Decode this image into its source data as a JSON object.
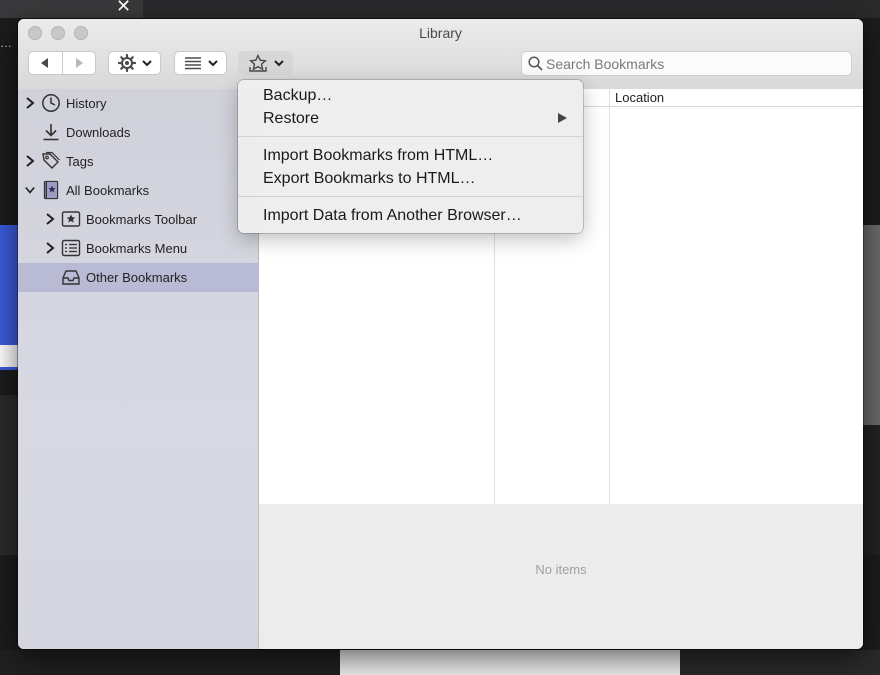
{
  "window": {
    "title": "Library"
  },
  "toolbar": {
    "search": {
      "placeholder": "Search Bookmarks",
      "value": ""
    }
  },
  "sidebar": {
    "items": [
      {
        "label": "History",
        "icon": "clock-icon",
        "expandable": true,
        "expanded": false
      },
      {
        "label": "Downloads",
        "icon": "download-icon",
        "expandable": false
      },
      {
        "label": "Tags",
        "icon": "tags-icon",
        "expandable": true,
        "expanded": false
      },
      {
        "label": "All Bookmarks",
        "icon": "bookmarks-book-icon",
        "expandable": true,
        "expanded": true
      },
      {
        "label": "Bookmarks Toolbar",
        "icon": "star-toolbar-icon",
        "expandable": true,
        "expanded": false
      },
      {
        "label": "Bookmarks Menu",
        "icon": "menu-list-icon",
        "expandable": true,
        "expanded": false
      },
      {
        "label": "Other Bookmarks",
        "icon": "inbox-tray-icon",
        "expandable": false,
        "selected": true
      }
    ]
  },
  "columns": {
    "location": "Location"
  },
  "details": {
    "empty_text": "No items"
  },
  "import_menu": {
    "items": [
      {
        "label": "Backup…"
      },
      {
        "label": "Restore",
        "submenu": true
      },
      {
        "label": "Import Bookmarks from HTML…"
      },
      {
        "label": "Export Bookmarks to HTML…"
      },
      {
        "label": "Import Data from Another Browser…"
      }
    ]
  },
  "colors": {
    "sidebar_bg": "#d4d5df",
    "sidebar_selected": "#b9bbd4",
    "window_bg": "#ececec"
  }
}
